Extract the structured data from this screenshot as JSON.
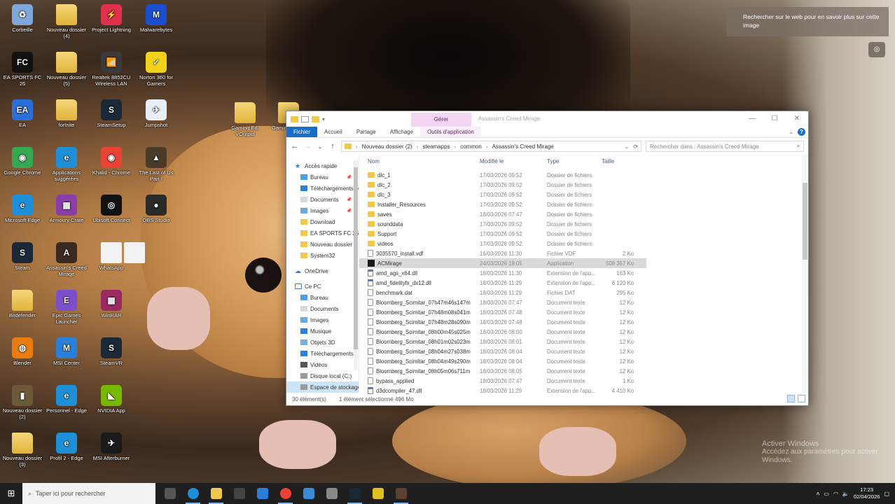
{
  "desktop": {
    "icons": [
      {
        "label": "Corbeille",
        "icon": "recycle-bin-icon",
        "color": "#7fa7d8",
        "glyph": "♻"
      },
      {
        "label": "Nouveau dossier (4)",
        "icon": "folder-icon",
        "color": "#f0c84c",
        "glyph": ""
      },
      {
        "label": "Project Lightning",
        "icon": "lightning-app-icon",
        "color": "#e0304c",
        "glyph": "⚡"
      },
      {
        "label": "Malwarebytes",
        "icon": "malwarebytes-icon",
        "color": "#1a4fd0",
        "glyph": "M"
      },
      {
        "label": "EA SPORTS FC 26",
        "icon": "fc26-icon",
        "color": "#111111",
        "glyph": "FC"
      },
      {
        "label": "Nouveau dossier (5)",
        "icon": "folder-icon",
        "color": "#f0c84c",
        "glyph": ""
      },
      {
        "label": "Realtek 8852CU Wireless LAN",
        "icon": "wireless-icon",
        "color": "#3a3a3a",
        "glyph": "📶"
      },
      {
        "label": "Norton 360 for Gamers",
        "icon": "norton-icon",
        "color": "#f2d21c",
        "glyph": "✓"
      },
      {
        "label": "EA",
        "icon": "ea-app-icon",
        "color": "#2b6fd8",
        "glyph": "EA"
      },
      {
        "label": "fortnite",
        "icon": "folder-icon",
        "color": "#f0c84c",
        "glyph": ""
      },
      {
        "label": "SteamSetup",
        "icon": "steam-setup-icon",
        "color": "#1b2838",
        "glyph": "S"
      },
      {
        "label": "Jumpshot",
        "icon": "jumpshot-icon",
        "color": "#e8eef5",
        "glyph": "✈"
      },
      {
        "label": "Google Chrome",
        "icon": "chrome-icon",
        "color": "#34a853",
        "glyph": "◉"
      },
      {
        "label": "Applications suggérées",
        "icon": "edge-icon",
        "color": "#1f8fd8",
        "glyph": "e"
      },
      {
        "label": "Khalid - Chrome",
        "icon": "chrome-icon",
        "color": "#ea4335",
        "glyph": "◉"
      },
      {
        "label": "The Last of Us Part I",
        "icon": "tlou-icon",
        "color": "#4a3a2a",
        "glyph": "▲"
      },
      {
        "label": "Microsoft Edge",
        "icon": "edge-icon",
        "color": "#1f8fd8",
        "glyph": "e"
      },
      {
        "label": "Armoury Crate",
        "icon": "winrar-icon",
        "color": "#8a3ea8",
        "glyph": "▦"
      },
      {
        "label": "Ubisoft Connect",
        "icon": "ubisoft-icon",
        "color": "#111111",
        "glyph": "◎"
      },
      {
        "label": "OBS Studio",
        "icon": "obs-icon",
        "color": "#2a2a2a",
        "glyph": "●"
      },
      {
        "label": "Steam",
        "icon": "steam-icon",
        "color": "#1b2838",
        "glyph": "S"
      },
      {
        "label": "Assassin's Creed Mirage",
        "icon": "ac-mirage-icon",
        "color": "#3a2a22",
        "glyph": "A"
      },
      {
        "label": "WhatsApp",
        "icon": "file-icon",
        "color": "#f2f2f2",
        "glyph": ""
      },
      {
        "label": "",
        "icon": "file-icon",
        "color": "#f2f2f2",
        "glyph": ""
      },
      {
        "label": "Bitdefender",
        "icon": "folder-icon",
        "color": "#f0c84c",
        "glyph": ""
      },
      {
        "label": "Epic Games Launcher",
        "icon": "epic-icon",
        "color": "#7b4fc9",
        "glyph": "E"
      },
      {
        "label": "WinRAR",
        "icon": "winrar-icon",
        "color": "#9a2a62",
        "glyph": "▦"
      },
      {
        "label": "Blender",
        "icon": "blender-icon",
        "color": "#e87d0d",
        "glyph": "◍"
      },
      {
        "label": "MSI Center",
        "icon": "msi-icon",
        "color": "#2a7fd8",
        "glyph": "M"
      },
      {
        "label": "SteamVR",
        "icon": "steam-icon",
        "color": "#1b2838",
        "glyph": "S"
      },
      {
        "label": "Nouveau dossier (2)",
        "icon": "ac-game-icon",
        "color": "#6a5a3a",
        "glyph": "▮"
      },
      {
        "label": "Personnel - Edge",
        "icon": "edge-icon",
        "color": "#1f8fd8",
        "glyph": "e"
      },
      {
        "label": "NVIDIA App",
        "icon": "nvidia-icon",
        "color": "#76b900",
        "glyph": "◣"
      },
      {
        "label": "Nouveau dossier (3)",
        "icon": "folder-icon",
        "color": "#f0c84c",
        "glyph": ""
      },
      {
        "label": "Profil 2 - Edge",
        "icon": "edge-icon",
        "color": "#1f8fd8",
        "glyph": "e"
      },
      {
        "label": "MSI Afterburner",
        "icon": "afterburner-icon",
        "color": "#1a1a1a",
        "glyph": "✈"
      },
      {
        "label": "Gaming Ed. VOutput",
        "icon": "folder-icon",
        "color": "#f0c84c",
        "glyph": ""
      },
      {
        "label": "Gaming Xoutp",
        "icon": "folder-icon",
        "color": "#f0c84c",
        "glyph": ""
      }
    ]
  },
  "bing": {
    "text": "Rechercher sur le web pour en savoir plus sur cette image"
  },
  "watermark": {
    "line1": "Activer Windows",
    "line2": "Accédez aux paramètres pour activer Windows."
  },
  "explorer": {
    "window_title": "Assassin's Creed Mirage",
    "context_tab": "Gérer",
    "ribbon_tabs": [
      "Fichier",
      "Accueil",
      "Partage",
      "Affichage",
      "Outils d'application"
    ],
    "breadcrumb": [
      "Nouveau dossier (2)",
      "steamapps",
      "common",
      "Assassin's Creed Mirage"
    ],
    "search_placeholder": "Rechercher dans : Assassin's Creed Mirage",
    "nav": {
      "quick_access": "Accès rapide",
      "quick_items": [
        "Bureau",
        "Téléchargements",
        "Documents",
        "Images",
        "Download",
        "EA SPORTS FC 26",
        "Nouveau dossier",
        "System32"
      ],
      "onedrive": "OneDrive",
      "this_pc": "Ce PC",
      "pc_items": [
        "Bureau",
        "Documents",
        "Images",
        "Musique",
        "Objets 3D",
        "Téléchargements",
        "Vidéos",
        "Disque local (C:)",
        "Espace de stockage"
      ]
    },
    "columns": [
      "Nom",
      "Modifié le",
      "Type",
      "Taille"
    ],
    "files": [
      {
        "name": "dlc_1",
        "date": "17/03/2026 09:52",
        "type": "Dossier de fichiers",
        "size": "",
        "kind": "folder"
      },
      {
        "name": "dlc_2",
        "date": "17/03/2026 09:52",
        "type": "Dossier de fichiers",
        "size": "",
        "kind": "folder"
      },
      {
        "name": "dlc_3",
        "date": "17/03/2026 09:52",
        "type": "Dossier de fichiers",
        "size": "",
        "kind": "folder"
      },
      {
        "name": "Installer_Resources",
        "date": "17/03/2026 09:52",
        "type": "Dossier de fichiers",
        "size": "",
        "kind": "folder"
      },
      {
        "name": "saves",
        "date": "18/03/2026 07:47",
        "type": "Dossier de fichiers",
        "size": "",
        "kind": "folder"
      },
      {
        "name": "sounddata",
        "date": "17/03/2026 09:52",
        "type": "Dossier de fichiers",
        "size": "",
        "kind": "folder"
      },
      {
        "name": "Support",
        "date": "17/03/2026 09:52",
        "type": "Dossier de fichiers",
        "size": "",
        "kind": "folder"
      },
      {
        "name": "videos",
        "date": "17/03/2026 09:52",
        "type": "Dossier de fichiers",
        "size": "",
        "kind": "folder"
      },
      {
        "name": "3035570_install.vdf",
        "date": "16/03/2026 11:30",
        "type": "Fichier VDF",
        "size": "2 Ko",
        "kind": "doc"
      },
      {
        "name": "ACMirage",
        "date": "24/03/2026 19:05",
        "type": "Application",
        "size": "508 357 Ko",
        "kind": "app"
      },
      {
        "name": "amd_ags_x64.dll",
        "date": "18/03/2026 11:30",
        "type": "Extension de l'app...",
        "size": "163 Ko",
        "kind": "dll"
      },
      {
        "name": "amd_fidelityfx_dx12.dll",
        "date": "18/03/2026 11:29",
        "type": "Extension de l'app...",
        "size": "6 120 Ko",
        "kind": "dll"
      },
      {
        "name": "benchmark.dat",
        "date": "18/03/2026 11:29",
        "type": "Fichier DAT",
        "size": "295 Ko",
        "kind": "doc"
      },
      {
        "name": "Bloomberg_Scimitar_07h47m46s147m",
        "date": "18/03/2026 07:47",
        "type": "Document texte",
        "size": "12 Ko",
        "kind": "doc"
      },
      {
        "name": "Bloomberg_Scimitar_07h48m08s041m",
        "date": "18/03/2026 07:48",
        "type": "Document texte",
        "size": "12 Ko",
        "kind": "doc"
      },
      {
        "name": "Bloomberg_Scimitar_07h48m28s090m",
        "date": "18/03/2026 07:48",
        "type": "Document texte",
        "size": "12 Ko",
        "kind": "doc"
      },
      {
        "name": "Bloomberg_Scimitar_08h00m45s025m",
        "date": "18/03/2026 08:00",
        "type": "Document texte",
        "size": "12 Ko",
        "kind": "doc"
      },
      {
        "name": "Bloomberg_Scimitar_08h01m02s023m",
        "date": "18/03/2026 08:01",
        "type": "Document texte",
        "size": "12 Ko",
        "kind": "doc"
      },
      {
        "name": "Bloomberg_Scimitar_08h04m27s038m",
        "date": "18/03/2026 08:04",
        "type": "Document texte",
        "size": "12 Ko",
        "kind": "doc"
      },
      {
        "name": "Bloomberg_Scimitar_08h04m49s290m",
        "date": "18/03/2026 08:04",
        "type": "Document texte",
        "size": "12 Ko",
        "kind": "doc"
      },
      {
        "name": "Bloomberg_Scimitar_08h05m06s711m",
        "date": "18/03/2026 08:05",
        "type": "Document texte",
        "size": "12 Ko",
        "kind": "doc"
      },
      {
        "name": "bypass_applied",
        "date": "18/03/2026 07:47",
        "type": "Document texte",
        "size": "1 Ko",
        "kind": "doc"
      },
      {
        "name": "d3dcompiler_47.dll",
        "date": "18/03/2026 11:29",
        "type": "Extension de l'app...",
        "size": "4 410 Ko",
        "kind": "dll"
      }
    ],
    "status": {
      "count": "30 élément(s)",
      "selection": "1 élément sélectionné  496 Mo"
    }
  },
  "taskbar": {
    "search_placeholder": "Taper ici pour rechercher",
    "apps": [
      {
        "icon": "task-view-icon",
        "color": "#555555"
      },
      {
        "icon": "edge-icon",
        "color": "#1f8fd8"
      },
      {
        "icon": "file-explorer-icon",
        "color": "#f0c84c"
      },
      {
        "icon": "calculator-icon",
        "color": "#444444"
      },
      {
        "icon": "mail-icon",
        "color": "#2a7fd8"
      },
      {
        "icon": "chrome-icon",
        "color": "#ea4335"
      },
      {
        "icon": "remote-desktop-icon",
        "color": "#3a8ad8"
      },
      {
        "icon": "settings-icon",
        "color": "#888888"
      },
      {
        "icon": "steam-icon",
        "color": "#1b2838"
      },
      {
        "icon": "norton-icon",
        "color": "#e0c020"
      },
      {
        "icon": "ac-mirage-icon",
        "color": "#5a4030"
      }
    ],
    "time": "17:23",
    "date": "02/04/2026"
  }
}
